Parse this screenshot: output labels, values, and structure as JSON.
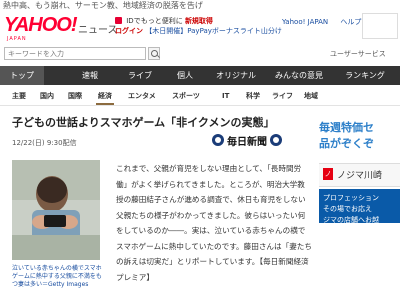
{
  "top_strip": "熱中高、もう崩れ、サーモン教、地域経済の脱落を告げ",
  "header": {
    "logo": "YAHOO!",
    "logo_sub": "JAPAN",
    "section": "ニュース",
    "promo_line1_prefix": "IDでもっと便利に",
    "promo_line1_link": "新規取得",
    "promo_line2_link": "ログイン",
    "promo_line2_text": "【木日開催】PayPayボーナスライト山分け",
    "right_link1": "Yahoo! JAPAN",
    "right_link2": "ヘルプ"
  },
  "search": {
    "placeholder": "キーワードを入力",
    "user_service": "ユーザーサービス"
  },
  "nav": {
    "items": [
      "トップ",
      "速報",
      "ライブ",
      "個人",
      "オリジナル",
      "みんなの意見",
      "ランキング"
    ],
    "active_index": 0
  },
  "subnav": {
    "items": [
      "主要",
      "国内",
      "国際",
      "経済",
      "エンタメ",
      "スポーツ",
      "IT",
      "科学",
      "ライフ",
      "地域"
    ],
    "active_index": 3
  },
  "article": {
    "title": "子どもの世話よりスマホゲーム「非イクメンの実態」",
    "date": "12/22(日) 9:30配信",
    "media": "毎日新聞",
    "caption": "泣いている赤ちゃんの横でスマホゲームに熱中する父親に不満をもつ妻は多い＝Getty Images",
    "body": "これまで、父親が育児をしない理由として、「長時間労働」がよく挙げられてきました。ところが、明治大学教授の藤田結子さんが進める調査で、休日も育児をしない父親たちの様子がわかってきました。彼らはいったい何をしているのか――。実は、泣いている赤ちゃんの横でスマホゲームに熱中していたのです。藤田さんは「妻たちの訴えは切実だ」とリポートしています。【毎日新聞経済プレミア】"
  },
  "sidebar": {
    "ad1_line1": "毎週特価セ",
    "ad1_line2": "品がぞくぞ",
    "ad2_text": "ノジマ川崎",
    "ad3_line1": "プロフェッション",
    "ad3_line2": "その場でお応え",
    "ad3_line3": "ジマの店舗へお越"
  },
  "colors": {
    "brand_red": "#ff0033",
    "nav_bg": "#333333",
    "link_blue": "#1a4ea0",
    "accent_blue": "#2c7fc9"
  }
}
